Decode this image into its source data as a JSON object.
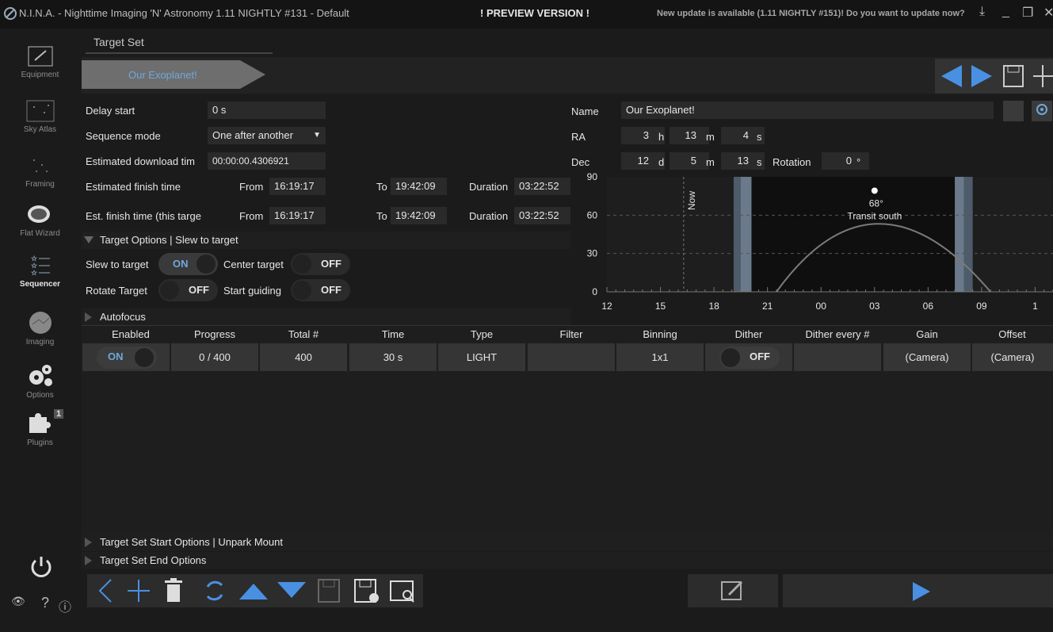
{
  "window": {
    "title": "N.I.N.A. - Nighttime Imaging 'N' Astronomy 1.11 NIGHTLY #131  -  Default",
    "preview": "! PREVIEW VERSION !",
    "update": "New update is available (1.11 NIGHTLY #151)! Do you want to update now?"
  },
  "sidebar": {
    "items": [
      {
        "label": "Equipment",
        "icon": "telescope-icon"
      },
      {
        "label": "Sky Atlas",
        "icon": "atlas-icon"
      },
      {
        "label": "Framing",
        "icon": "framing-icon"
      },
      {
        "label": "Flat Wizard",
        "icon": "flat-wizard-icon"
      },
      {
        "label": "Sequencer",
        "icon": "sequencer-icon"
      },
      {
        "label": "Imaging",
        "icon": "imaging-icon"
      },
      {
        "label": "Options",
        "icon": "gears-icon"
      },
      {
        "label": "Plugins",
        "icon": "puzzle-icon"
      }
    ],
    "plugins_badge": "1"
  },
  "header": {
    "tab": "Target Set",
    "target_tab": "Our Exoplanet!"
  },
  "form": {
    "delay_start_label": "Delay start",
    "delay_start_value": "0  s",
    "sequence_mode_label": "Sequence mode",
    "sequence_mode_value": "One after another",
    "est_download_label": "Estimated download tim",
    "est_download_value": "00:00:00.4306921",
    "est_finish_label": "Estimated finish time",
    "est_finish_target_label": "Est. finish time (this targe",
    "from_label": "From",
    "to_label": "To",
    "duration_label": "Duration",
    "from_value": "16:19:17",
    "to_value": "19:42:09",
    "duration_value": "03:22:52"
  },
  "target": {
    "name_label": "Name",
    "name_value": "Our Exoplanet!",
    "ra_label": "RA",
    "ra_h": "3",
    "ra_m": "13",
    "ra_s": "4",
    "dec_label": "Dec",
    "dec_d": "12",
    "dec_m": "5",
    "dec_s": "13",
    "rotation_label": "Rotation",
    "rotation_value": "0",
    "u_h": "h",
    "u_m": "m",
    "u_s": "s",
    "u_d": "d",
    "u_deg": "°"
  },
  "options": {
    "section": "Target Options | Slew to target",
    "slew_label": "Slew to target",
    "slew_state": "ON",
    "center_label": "Center target",
    "center_state": "OFF",
    "rotate_label": "Rotate Target",
    "rotate_state": "OFF",
    "guiding_label": "Start guiding",
    "guiding_state": "OFF",
    "autofocus": "Autofocus"
  },
  "table": {
    "headers": [
      "Enabled",
      "Progress",
      "Total #",
      "Time",
      "Type",
      "Filter",
      "Binning",
      "Dither",
      "Dither every #",
      "Gain",
      "Offset"
    ],
    "row": {
      "enabled": "ON",
      "progress": "0 / 400",
      "total": "400",
      "time": "30 s",
      "type": "LIGHT",
      "filter": "",
      "binning": "1x1",
      "dither": "OFF",
      "dither_every": "",
      "gain": "(Camera)",
      "offset": "(Camera)"
    }
  },
  "footer": {
    "start_options": "Target Set Start Options   | Unpark Mount",
    "end_options": "Target Set End Options"
  },
  "chart_data": {
    "type": "line",
    "x_ticks": [
      "12",
      "15",
      "18",
      "21",
      "00",
      "03",
      "06",
      "09",
      "1"
    ],
    "y_ticks": [
      "90",
      "60",
      "30",
      "0"
    ],
    "ylim": [
      0,
      90
    ],
    "now_label": "Now",
    "transit_value": "68°",
    "transit_label": "Transit south",
    "altitude_curve": [
      {
        "hour": 21.5,
        "alt": 0
      },
      {
        "hour": 27.0,
        "alt": 68
      },
      {
        "hour": 33.5,
        "alt": 0
      }
    ]
  }
}
